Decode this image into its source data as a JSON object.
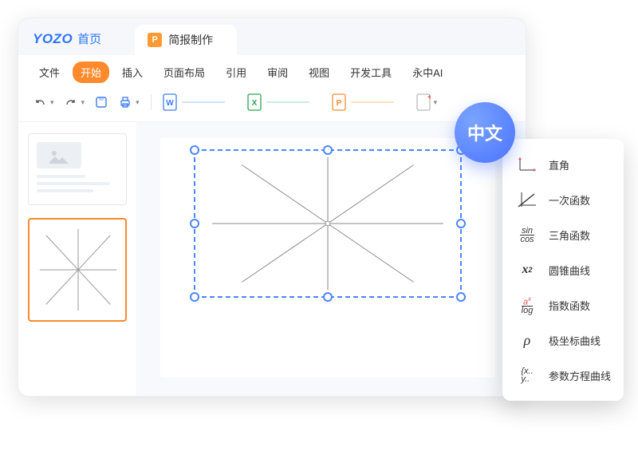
{
  "title": {
    "brand": "YOZO",
    "home": "首页",
    "doc_tab": "简报制作"
  },
  "menu": {
    "items": [
      "文件",
      "开始",
      "插入",
      "页面布局",
      "引用",
      "审阅",
      "视图",
      "开发工具",
      "永中AI"
    ],
    "active_index": 1
  },
  "toolbar": {
    "undo": "撤销",
    "redo": "重做",
    "save": "保存",
    "print": "打印",
    "doc_word": "W",
    "doc_excel": "X",
    "doc_ppt": "P",
    "new_doc": "+"
  },
  "badge": {
    "label": "中文"
  },
  "panel": {
    "items": [
      {
        "label": "直角"
      },
      {
        "label": "一次函数"
      },
      {
        "label": "三角函数"
      },
      {
        "label": "圆锥曲线"
      },
      {
        "label": "指数函数"
      },
      {
        "label": "极坐标曲线"
      },
      {
        "label": "参数方程曲线"
      }
    ]
  }
}
